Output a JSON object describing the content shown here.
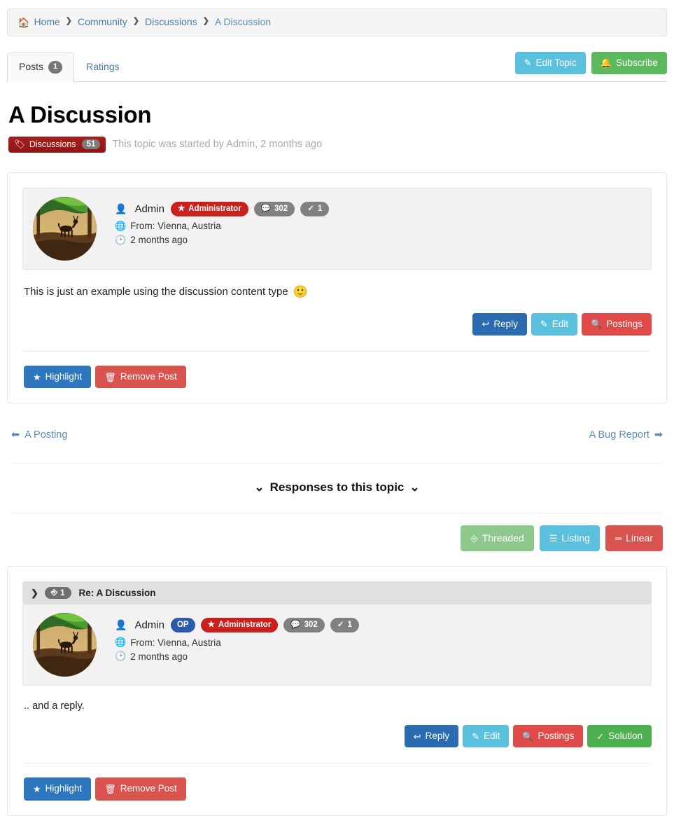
{
  "breadcrumb": {
    "home_icon": "home-icon",
    "items": [
      {
        "label": "Home"
      },
      {
        "label": "Community"
      },
      {
        "label": "Discussions"
      },
      {
        "label": "A Discussion"
      }
    ],
    "separator": "❯"
  },
  "tabs": [
    {
      "label": "Posts",
      "badge": "1",
      "active": true
    },
    {
      "label": "Ratings",
      "badge": "",
      "active": false
    }
  ],
  "header_buttons": [
    {
      "label": "Edit Topic",
      "icon": "pencil-icon",
      "color": "#5bc0de"
    },
    {
      "label": "Subscribe",
      "icon": "bell-icon",
      "color": "#5cb85c"
    }
  ],
  "topic": {
    "title": "A Discussion",
    "tag_label": "Discussions",
    "tag_count": "51",
    "tag_icon": "tag-icon",
    "tag_color": "#9e1b1b",
    "started_text": "This topic was started by Admin, 2 months ago"
  },
  "post": {
    "avatar": "deer-forest-avatar",
    "author": "Admin",
    "author_icon": "user-icon",
    "badges": [
      {
        "label": "Administrator",
        "icon": "star-icon",
        "type": "admin"
      },
      {
        "label": "302",
        "icon": "comment-icon",
        "type": "gray"
      },
      {
        "label": "1",
        "icon": "check-icon",
        "type": "gray"
      }
    ],
    "location_icon": "globe-icon",
    "location": "From: Vienna, Austria",
    "time_icon": "clock-icon",
    "time": "2 months ago",
    "body": "This is just an example using the discussion content type",
    "body_emoji": "🙂",
    "actions": [
      {
        "label": "Reply",
        "icon": "reply-icon",
        "color": "#2b6cb0"
      },
      {
        "label": "Edit",
        "icon": "edit-icon",
        "color": "#5bc0de"
      },
      {
        "label": "Postings",
        "icon": "search-icon",
        "color": "#e04a48"
      }
    ],
    "footer_actions": [
      {
        "label": "Highlight",
        "icon": "star-icon",
        "color": "#2e76bd"
      },
      {
        "label": "Remove Post",
        "icon": "trash-icon",
        "color": "#d9534f"
      }
    ]
  },
  "pager": {
    "prev_label": "A Posting",
    "prev_icon": "arrow-circle-left-icon",
    "next_label": "A Bug Report",
    "next_icon": "arrow-circle-right-icon"
  },
  "responses": {
    "heading": "Responses to this topic",
    "left_icon": "double-chevron-down-icon",
    "right_icon": "double-chevron-down-icon"
  },
  "view_modes": [
    {
      "label": "Threaded",
      "icon": "sitemap-icon",
      "color": "#8dc98d",
      "active": true
    },
    {
      "label": "Listing",
      "icon": "list-icon",
      "color": "#5bc0de",
      "active": false
    },
    {
      "label": "Linear",
      "icon": "bars-icon",
      "color": "#d9534f",
      "active": false
    }
  ],
  "reply": {
    "collapse_icon": "chevron-right-icon",
    "thread_icon": "sitemap-icon",
    "thread_count": "1",
    "head_title": "Re: A Discussion",
    "avatar": "deer-forest-avatar",
    "author": "Admin",
    "author_icon": "user-icon",
    "badges": [
      {
        "label": "OP",
        "icon": "",
        "type": "op"
      },
      {
        "label": "Administrator",
        "icon": "star-icon",
        "type": "admin"
      },
      {
        "label": "302",
        "icon": "comment-icon",
        "type": "gray"
      },
      {
        "label": "1",
        "icon": "check-icon",
        "type": "gray"
      }
    ],
    "location_icon": "globe-icon",
    "location": "From: Vienna, Austria",
    "time_icon": "clock-icon",
    "time": "2 months ago",
    "body": ".. and a reply.",
    "actions": [
      {
        "label": "Reply",
        "icon": "reply-icon",
        "color": "#2b6cb0"
      },
      {
        "label": "Edit",
        "icon": "edit-icon",
        "color": "#5bc0de"
      },
      {
        "label": "Postings",
        "icon": "search-icon",
        "color": "#e04a48"
      },
      {
        "label": "Solution",
        "icon": "check-icon",
        "color": "#4caf50"
      }
    ],
    "footer_actions": [
      {
        "label": "Highlight",
        "icon": "star-icon",
        "color": "#2e76bd"
      },
      {
        "label": "Remove Post",
        "icon": "trash-icon",
        "color": "#d9534f"
      }
    ]
  }
}
